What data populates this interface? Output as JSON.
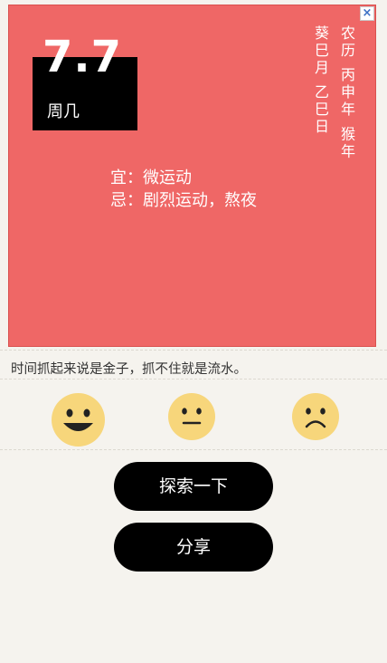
{
  "card": {
    "close_label": "×",
    "date": "7.7",
    "weekday": "周几",
    "lunar_col1": "农历 丙申年 猴年",
    "lunar_col2": "葵巳月 乙巳日",
    "suitable": "宜：微运动",
    "avoid": "忌：剧烈运动，熬夜"
  },
  "motto": "时间抓起来说是金子，抓不住就是流水。",
  "moods": [
    {
      "name": "happy-face-icon"
    },
    {
      "name": "neutral-face-icon"
    },
    {
      "name": "sad-face-icon"
    }
  ],
  "buttons": {
    "explore": "探索一下",
    "share": "分享"
  },
  "colors": {
    "card_bg": "#ef6766",
    "face": "#f7d67b",
    "button": "#000000"
  }
}
